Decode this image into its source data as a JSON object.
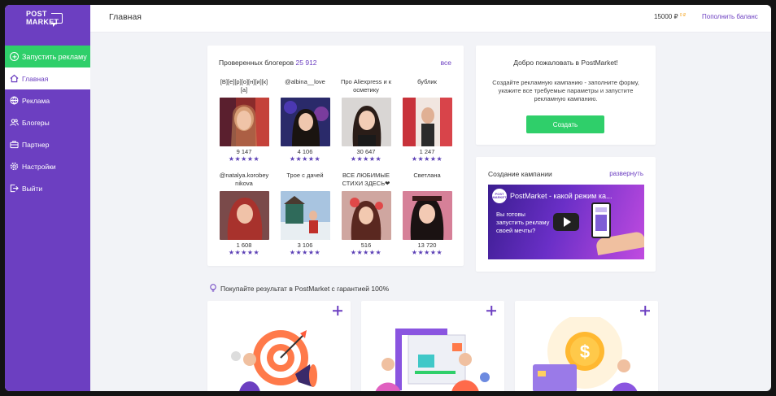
{
  "brand": {
    "logo_line1": "POST",
    "logo_line2": "MARKET"
  },
  "sidebar": {
    "launch_label": "Запустить рекламу",
    "items": [
      {
        "label": "Главная",
        "icon": "home-icon",
        "active": true
      },
      {
        "label": "Реклама",
        "icon": "globe-icon"
      },
      {
        "label": "Блогеры",
        "icon": "users-icon"
      },
      {
        "label": "Партнер",
        "icon": "partner-icon"
      },
      {
        "label": "Настройки",
        "icon": "gear-icon"
      },
      {
        "label": "Выйти",
        "icon": "logout-icon"
      }
    ]
  },
  "header": {
    "title": "Главная",
    "balance": "15000 ₽",
    "balance_badge": "0 ₽",
    "topup_label": "Пополнить баланс"
  },
  "bloggers": {
    "title": "Проверенных блогеров",
    "count": "25 912",
    "all_label": "все",
    "stars": "★★★★★",
    "items": [
      {
        "name": "[В][е][р][о][н][и][к][а]",
        "subs": "9 147"
      },
      {
        "name": "@albina__love",
        "subs": "4 106"
      },
      {
        "name": "Про Aliexpress и косметику",
        "subs": "30 647"
      },
      {
        "name": "бублик",
        "subs": "1 247"
      },
      {
        "name": "@natalya.korobeynikova",
        "subs": "1 608"
      },
      {
        "name": "Трое с дачей",
        "subs": "3 106"
      },
      {
        "name": "ВСЕ ЛЮБИМЫЕ СТИХИ ЗДЕСЬ❤",
        "subs": "516"
      },
      {
        "name": "Светлана",
        "subs": "13 720"
      }
    ]
  },
  "welcome": {
    "title": "Добро пожаловать в PostMarket!",
    "text": "Создайте рекламную кампанию - заполните форму, укажите все требуемые параметры и запустите рекламную кампанию.",
    "create_label": "Создать"
  },
  "campaign": {
    "title": "Создание кампании",
    "expand_label": "развернуть",
    "video_logo": "POST MARKET",
    "video_title": "PostMarket - какой режим ка...",
    "video_text": "Вы готовы запустить рекламу своей мечты?"
  },
  "promo": {
    "title": "Покупайте результат в PostMarket с гарантией 100%"
  },
  "colors": {
    "accent": "#6c3fc1",
    "green": "#2fcf6a",
    "background": "#f2f3f7"
  }
}
